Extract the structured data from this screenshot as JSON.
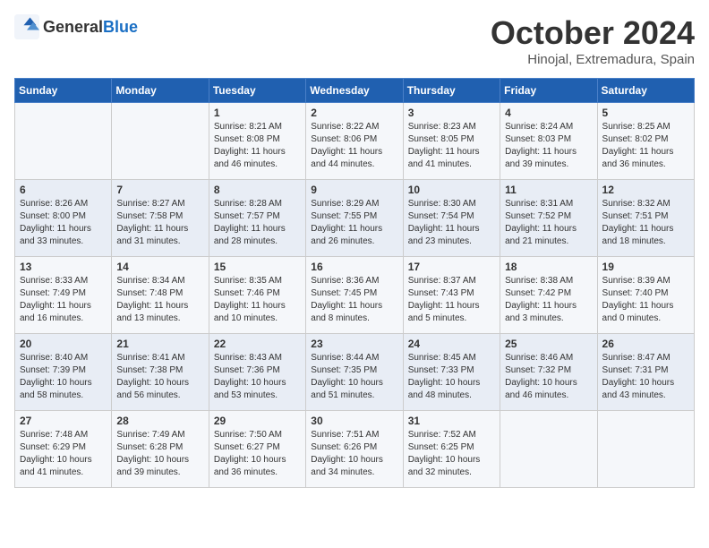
{
  "logo": {
    "text_general": "General",
    "text_blue": "Blue"
  },
  "title": "October 2024",
  "subtitle": "Hinojal, Extremadura, Spain",
  "headers": [
    "Sunday",
    "Monday",
    "Tuesday",
    "Wednesday",
    "Thursday",
    "Friday",
    "Saturday"
  ],
  "weeks": [
    [
      {
        "day": "",
        "info": ""
      },
      {
        "day": "",
        "info": ""
      },
      {
        "day": "1",
        "info": "Sunrise: 8:21 AM\nSunset: 8:08 PM\nDaylight: 11 hours and 46 minutes."
      },
      {
        "day": "2",
        "info": "Sunrise: 8:22 AM\nSunset: 8:06 PM\nDaylight: 11 hours and 44 minutes."
      },
      {
        "day": "3",
        "info": "Sunrise: 8:23 AM\nSunset: 8:05 PM\nDaylight: 11 hours and 41 minutes."
      },
      {
        "day": "4",
        "info": "Sunrise: 8:24 AM\nSunset: 8:03 PM\nDaylight: 11 hours and 39 minutes."
      },
      {
        "day": "5",
        "info": "Sunrise: 8:25 AM\nSunset: 8:02 PM\nDaylight: 11 hours and 36 minutes."
      }
    ],
    [
      {
        "day": "6",
        "info": "Sunrise: 8:26 AM\nSunset: 8:00 PM\nDaylight: 11 hours and 33 minutes."
      },
      {
        "day": "7",
        "info": "Sunrise: 8:27 AM\nSunset: 7:58 PM\nDaylight: 11 hours and 31 minutes."
      },
      {
        "day": "8",
        "info": "Sunrise: 8:28 AM\nSunset: 7:57 PM\nDaylight: 11 hours and 28 minutes."
      },
      {
        "day": "9",
        "info": "Sunrise: 8:29 AM\nSunset: 7:55 PM\nDaylight: 11 hours and 26 minutes."
      },
      {
        "day": "10",
        "info": "Sunrise: 8:30 AM\nSunset: 7:54 PM\nDaylight: 11 hours and 23 minutes."
      },
      {
        "day": "11",
        "info": "Sunrise: 8:31 AM\nSunset: 7:52 PM\nDaylight: 11 hours and 21 minutes."
      },
      {
        "day": "12",
        "info": "Sunrise: 8:32 AM\nSunset: 7:51 PM\nDaylight: 11 hours and 18 minutes."
      }
    ],
    [
      {
        "day": "13",
        "info": "Sunrise: 8:33 AM\nSunset: 7:49 PM\nDaylight: 11 hours and 16 minutes."
      },
      {
        "day": "14",
        "info": "Sunrise: 8:34 AM\nSunset: 7:48 PM\nDaylight: 11 hours and 13 minutes."
      },
      {
        "day": "15",
        "info": "Sunrise: 8:35 AM\nSunset: 7:46 PM\nDaylight: 11 hours and 10 minutes."
      },
      {
        "day": "16",
        "info": "Sunrise: 8:36 AM\nSunset: 7:45 PM\nDaylight: 11 hours and 8 minutes."
      },
      {
        "day": "17",
        "info": "Sunrise: 8:37 AM\nSunset: 7:43 PM\nDaylight: 11 hours and 5 minutes."
      },
      {
        "day": "18",
        "info": "Sunrise: 8:38 AM\nSunset: 7:42 PM\nDaylight: 11 hours and 3 minutes."
      },
      {
        "day": "19",
        "info": "Sunrise: 8:39 AM\nSunset: 7:40 PM\nDaylight: 11 hours and 0 minutes."
      }
    ],
    [
      {
        "day": "20",
        "info": "Sunrise: 8:40 AM\nSunset: 7:39 PM\nDaylight: 10 hours and 58 minutes."
      },
      {
        "day": "21",
        "info": "Sunrise: 8:41 AM\nSunset: 7:38 PM\nDaylight: 10 hours and 56 minutes."
      },
      {
        "day": "22",
        "info": "Sunrise: 8:43 AM\nSunset: 7:36 PM\nDaylight: 10 hours and 53 minutes."
      },
      {
        "day": "23",
        "info": "Sunrise: 8:44 AM\nSunset: 7:35 PM\nDaylight: 10 hours and 51 minutes."
      },
      {
        "day": "24",
        "info": "Sunrise: 8:45 AM\nSunset: 7:33 PM\nDaylight: 10 hours and 48 minutes."
      },
      {
        "day": "25",
        "info": "Sunrise: 8:46 AM\nSunset: 7:32 PM\nDaylight: 10 hours and 46 minutes."
      },
      {
        "day": "26",
        "info": "Sunrise: 8:47 AM\nSunset: 7:31 PM\nDaylight: 10 hours and 43 minutes."
      }
    ],
    [
      {
        "day": "27",
        "info": "Sunrise: 7:48 AM\nSunset: 6:29 PM\nDaylight: 10 hours and 41 minutes."
      },
      {
        "day": "28",
        "info": "Sunrise: 7:49 AM\nSunset: 6:28 PM\nDaylight: 10 hours and 39 minutes."
      },
      {
        "day": "29",
        "info": "Sunrise: 7:50 AM\nSunset: 6:27 PM\nDaylight: 10 hours and 36 minutes."
      },
      {
        "day": "30",
        "info": "Sunrise: 7:51 AM\nSunset: 6:26 PM\nDaylight: 10 hours and 34 minutes."
      },
      {
        "day": "31",
        "info": "Sunrise: 7:52 AM\nSunset: 6:25 PM\nDaylight: 10 hours and 32 minutes."
      },
      {
        "day": "",
        "info": ""
      },
      {
        "day": "",
        "info": ""
      }
    ]
  ]
}
